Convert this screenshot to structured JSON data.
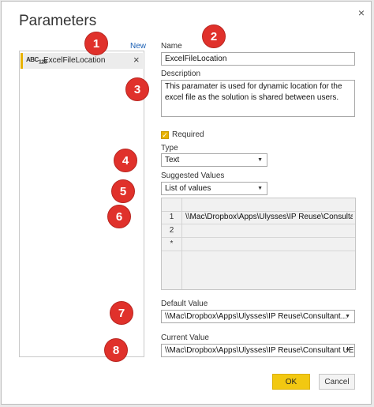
{
  "dialog": {
    "title": "Parameters",
    "close_glyph": "×"
  },
  "list": {
    "new_label": "New",
    "items": [
      {
        "type_icon": "ABC",
        "type_icon_sub": "123",
        "label": "ExcelFileLocation",
        "remove_glyph": "×"
      }
    ]
  },
  "form": {
    "name_label": "Name",
    "name_value": "ExcelFileLocation",
    "description_label": "Description",
    "description_value": "This paramater is used for dynamic location for the excel file as the solution is shared between users.",
    "required_label": "Required",
    "required_checked": true,
    "type_label": "Type",
    "type_value": "Text",
    "suggested_label": "Suggested Values",
    "suggested_value": "List of values",
    "values_rows": [
      {
        "num": "1",
        "value": "\\\\Mac\\Dropbox\\Apps\\Ulysses\\IP Reuse\\Consultant UI"
      },
      {
        "num": "2",
        "value": ""
      },
      {
        "num": "*",
        "value": ""
      }
    ],
    "default_label": "Default Value",
    "default_value": "\\\\Mac\\Dropbox\\Apps\\Ulysses\\IP Reuse\\Consultant...",
    "current_label": "Current Value",
    "current_value": "\\\\Mac\\Dropbox\\Apps\\Ulysses\\IP Reuse\\Consultant UE"
  },
  "buttons": {
    "ok_label": "OK",
    "cancel_label": "Cancel"
  },
  "callouts": [
    "1",
    "2",
    "3",
    "4",
    "5",
    "6",
    "7",
    "8"
  ],
  "colors": {
    "accent": "#f2c811",
    "callout": "#e0312b",
    "link": "#1a5fb4"
  }
}
